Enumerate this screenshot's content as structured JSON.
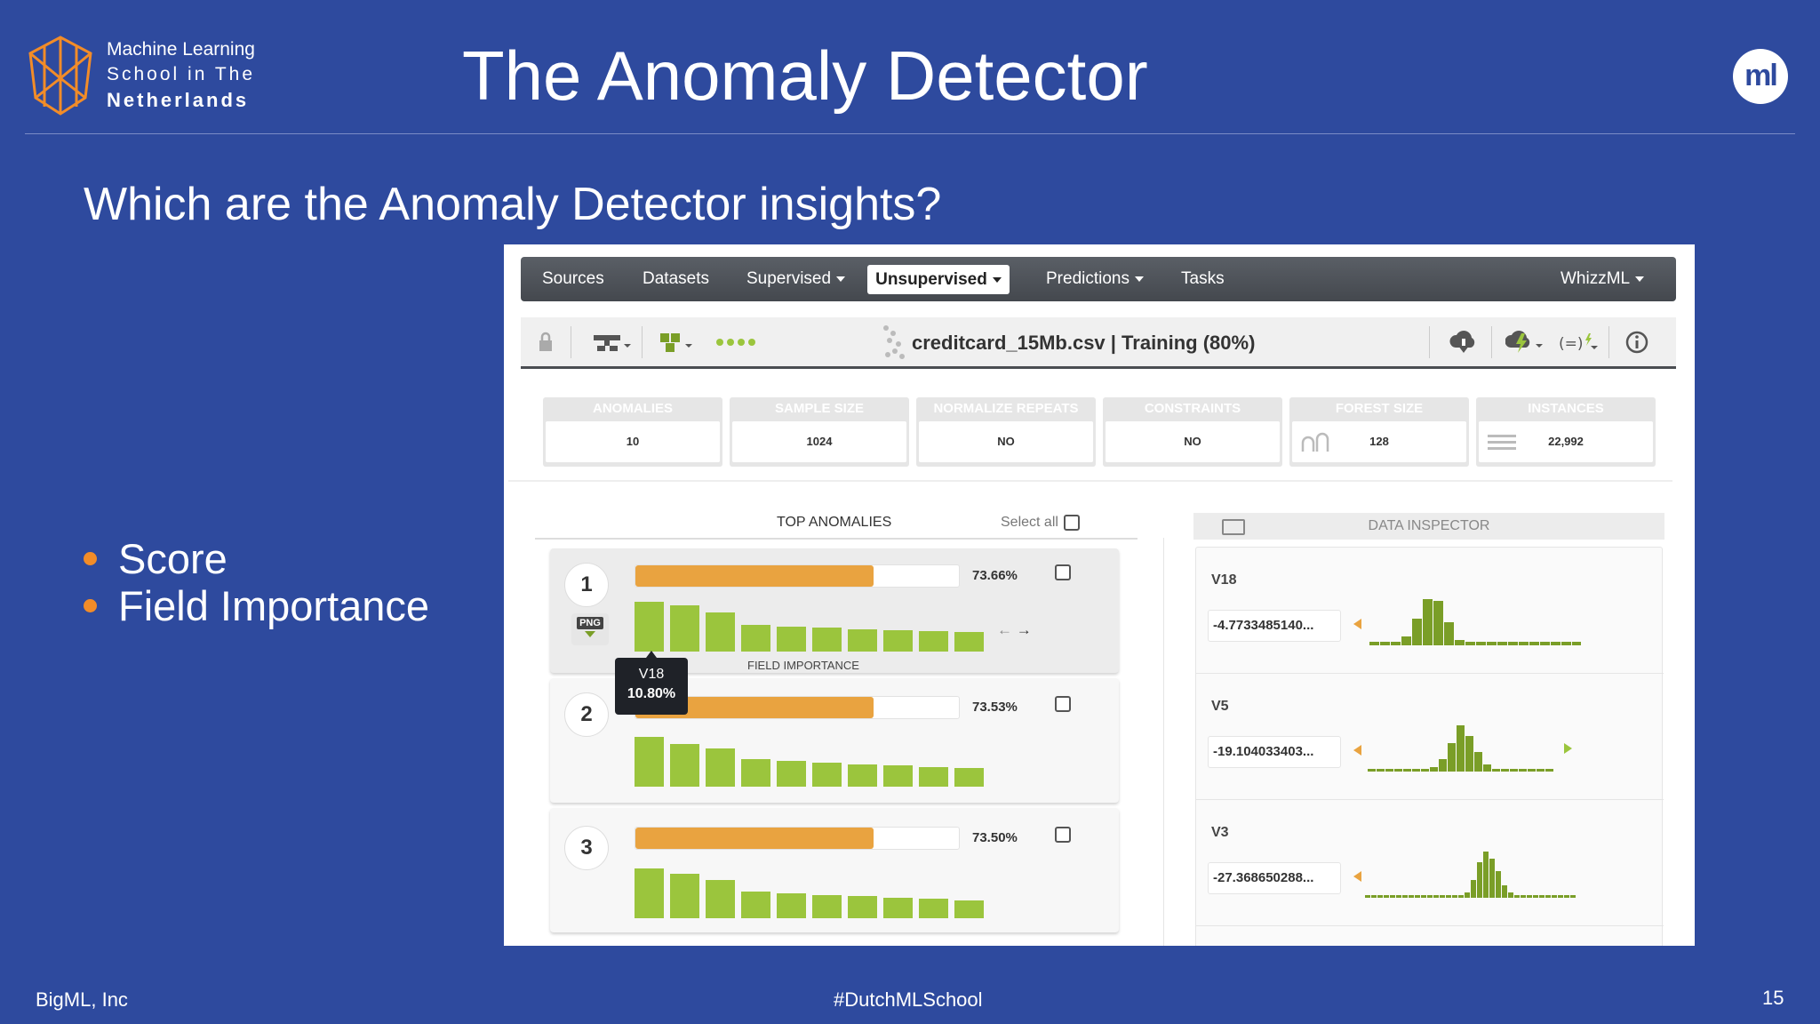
{
  "slide": {
    "school_line1": "Machine Learning",
    "school_line2": "School in The",
    "school_line3": "Netherlands",
    "title": "The Anomaly Detector",
    "logo_text": "ml",
    "question": "Which are the Anomaly Detector insights?",
    "bullets": [
      "Score",
      "Field Importance"
    ],
    "footer_left": "BigML, Inc",
    "footer_center": "#DutchMLSchool",
    "page_number": "15"
  },
  "app": {
    "nav": {
      "sources": "Sources",
      "datasets": "Datasets",
      "supervised": "Supervised",
      "unsupervised": "Unsupervised",
      "predictions": "Predictions",
      "tasks": "Tasks",
      "whizzml": "WhizzML"
    },
    "toolbar": {
      "title": "creditcard_15Mb.csv | Training (80%)"
    },
    "stats": [
      {
        "label": "ANOMALIES",
        "value": "10"
      },
      {
        "label": "SAMPLE SIZE",
        "value": "1024"
      },
      {
        "label": "NORMALIZE REPEATS",
        "value": "NO"
      },
      {
        "label": "CONSTRAINTS",
        "value": "NO"
      },
      {
        "label": "FOREST SIZE",
        "value": "128"
      },
      {
        "label": "INSTANCES",
        "value": "22,992"
      }
    ],
    "top_anomalies": {
      "title": "TOP ANOMALIES",
      "select_all": "Select all",
      "field_importance_label": "FIELD IMPORTANCE",
      "tooltip_field": "V18",
      "tooltip_value": "10.80%",
      "items": [
        {
          "rank": "1",
          "score_label": "73.66%",
          "score": 0.7366
        },
        {
          "rank": "2",
          "score_label": "73.53%",
          "score": 0.7353
        },
        {
          "rank": "3",
          "score_label": "73.50%",
          "score": 0.735
        }
      ]
    },
    "data_inspector": {
      "title": "DATA INSPECTOR",
      "fields": [
        {
          "name": "V18",
          "value": "-4.7733485140..."
        },
        {
          "name": "V5",
          "value": "-19.104033403..."
        },
        {
          "name": "V3",
          "value": "-27.368650288..."
        }
      ]
    }
  }
}
